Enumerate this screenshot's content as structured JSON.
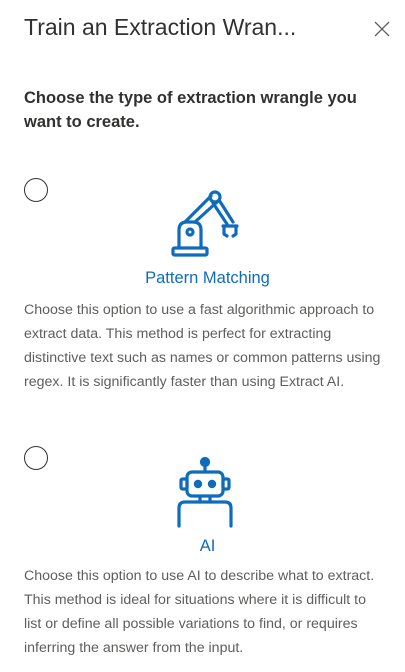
{
  "panel": {
    "title": "Train an Extraction Wran...",
    "close_icon": "close-icon",
    "prompt": "Choose the type of extraction wrangle you want to create."
  },
  "options": [
    {
      "selected": false,
      "icon": "robotic-arm-icon",
      "title": "Pattern Matching",
      "description": "Choose this option to use a fast algorithmic approach to extract data. This method is perfect for extracting distinctive text such as names or common patterns using regex. It is significantly faster than using Extract AI."
    },
    {
      "selected": false,
      "icon": "robot-icon",
      "title": "AI",
      "description": "Choose this option to use AI to describe what to extract. This method is ideal for situations where it is difficult to list or define all possible variations to find, or requires inferring the answer from the input."
    }
  ],
  "colors": {
    "accent": "#0f6cbd",
    "text": "#323130",
    "secondary_text": "#605e5c"
  }
}
